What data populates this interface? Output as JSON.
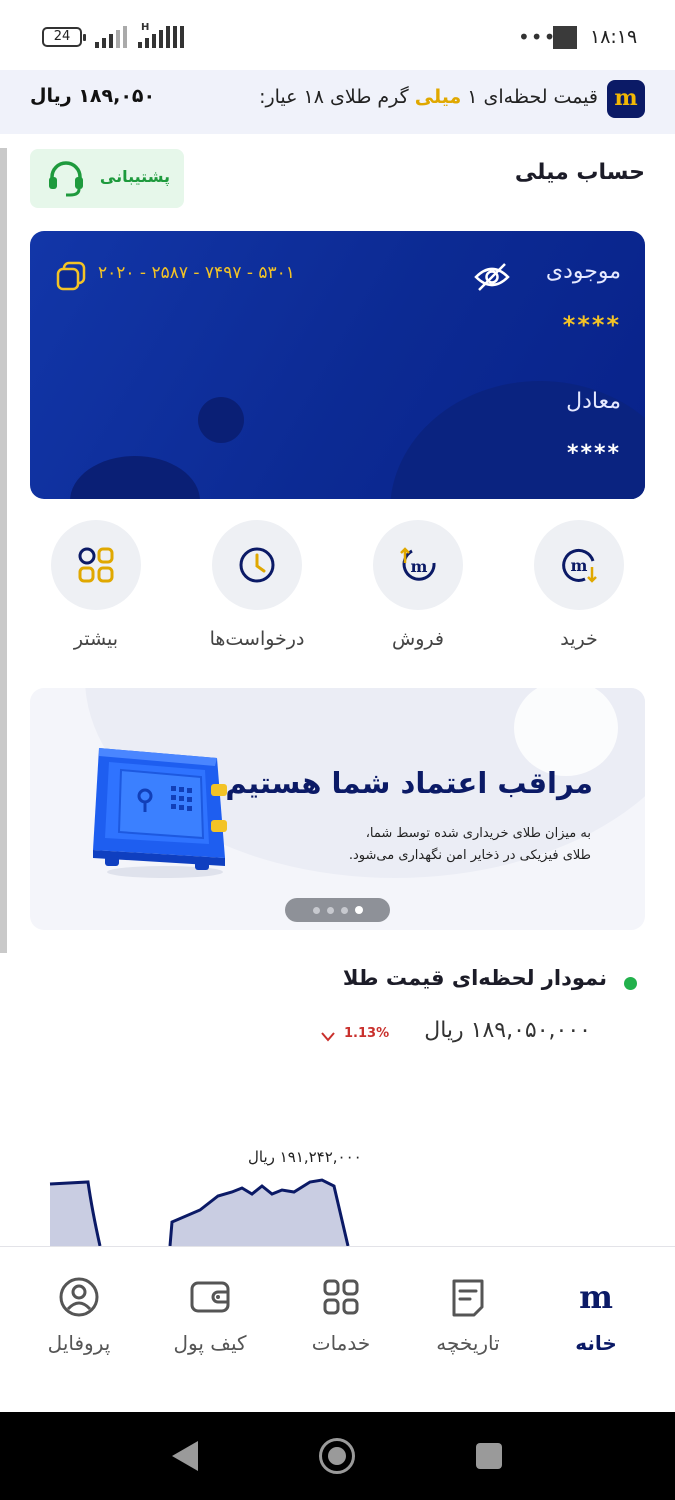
{
  "status_bar": {
    "battery": "24",
    "network": "H",
    "time": "۱۸:۱۹",
    "dots": "•••"
  },
  "price_strip": {
    "logo": "m",
    "label_prefix": "قیمت لحظه‌ای ۱ ",
    "label_highlight": "میلی",
    "label_suffix": " گرم طلای ۱۸ عیار:",
    "value": "۱۸۹,۰۵۰ ریال"
  },
  "account": {
    "title": "حساب میلی",
    "support_label": "پشتیبانی"
  },
  "card": {
    "balance_label": "موجودی",
    "balance_value": "****",
    "equivalent_label": "معادل",
    "equivalent_value": "****",
    "account_number": "۲۰۲۰ - ۲۵۸۷ - ۷۴۹۷ - ۵۳۰۱"
  },
  "actions": [
    {
      "label": "خرید",
      "icon": "buy-icon"
    },
    {
      "label": "فروش",
      "icon": "sell-icon"
    },
    {
      "label": "درخواست‌ها",
      "icon": "clock-icon"
    },
    {
      "label": "بیشتر",
      "icon": "more-apps-icon"
    }
  ],
  "banner": {
    "title": "مراقب اعتماد شما هستیم",
    "subtitle_line1": "به میزان طلای خریداری شده توسط شما،",
    "subtitle_line2": "طلای فیزیکی در ذخایر امن نگهداری می‌شود.",
    "slide_count": 4,
    "active_slide": 1
  },
  "live_chart": {
    "title": "نمودار لحظه‌ای قیمت طلا",
    "current_price": "۱۸۹,۰۵۰,۰۰۰ ریال",
    "change": "1.13%",
    "change_direction": "down",
    "peak_label": "۱۹۱,۲۴۲,۰۰۰ ریال",
    "line_color": "#0b1a66",
    "fill_color": "#c9cde2"
  },
  "bottom_nav": [
    {
      "label": "خانه",
      "icon": "home-logo-icon",
      "active": true
    },
    {
      "label": "تاریخچه",
      "icon": "history-icon",
      "active": false
    },
    {
      "label": "خدمات",
      "icon": "services-icon",
      "active": false
    },
    {
      "label": "کیف پول",
      "icon": "wallet-icon",
      "active": false
    },
    {
      "label": "پروفایل",
      "icon": "profile-icon",
      "active": false
    }
  ],
  "colors": {
    "brand_navy": "#0b1a66",
    "gold": "#f3c326",
    "support_green": "#1e9a3d",
    "down_red": "#c9302c"
  }
}
